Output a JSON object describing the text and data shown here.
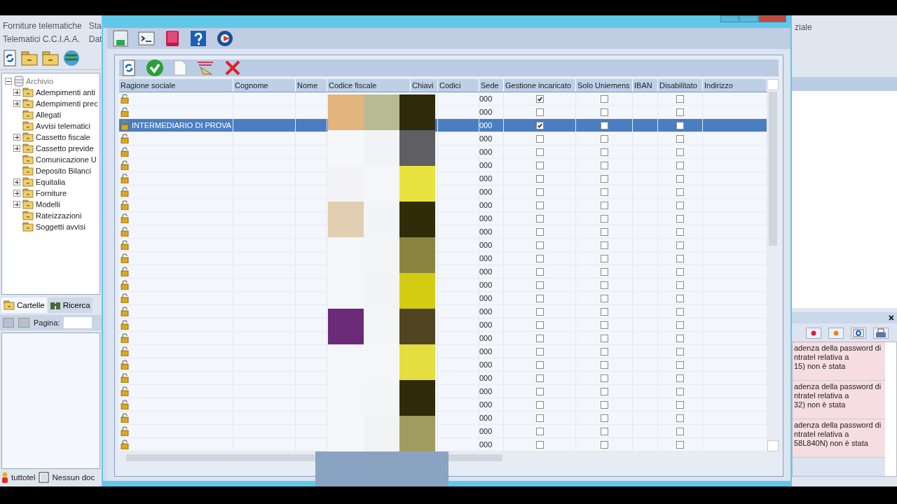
{
  "background_app": {
    "menu": [
      {
        "label": "Forniture telematiche"
      },
      {
        "label": "Sta"
      },
      {
        "label": "Telematici C.C.I.A.A."
      },
      {
        "label": "Dat"
      }
    ],
    "tree": {
      "label": "Archivio",
      "expanded": true,
      "children": [
        {
          "label": "Adempimenti anti",
          "collapsed": true
        },
        {
          "label": "Adempimenti prec",
          "collapsed": true
        },
        {
          "label": "Allegati",
          "collapsed": false
        },
        {
          "label": "Avvisi telematici",
          "collapsed": false
        },
        {
          "label": "Cassetto fiscale",
          "collapsed": true
        },
        {
          "label": "Cassetto previde",
          "collapsed": true
        },
        {
          "label": "Comunicazione U",
          "collapsed": false
        },
        {
          "label": "Deposito Bilanci",
          "collapsed": false
        },
        {
          "label": "Equitalia",
          "collapsed": true
        },
        {
          "label": "Forniture",
          "collapsed": true
        },
        {
          "label": "Modelli",
          "collapsed": true
        },
        {
          "label": "Rateizzazioni",
          "collapsed": false
        },
        {
          "label": "Soggetti avvisi",
          "collapsed": false
        }
      ]
    },
    "tabs": [
      {
        "label": "Cartelle",
        "selected": true
      },
      {
        "label": "Ricerca",
        "selected": false
      }
    ],
    "page_label": "Pagina:",
    "status_bar": {
      "user": "tuttotel",
      "document": "Nessun doc"
    },
    "right_menu": "ziale",
    "messages_panel": {
      "close": "×",
      "messages": [
        {
          "text": "adenza della password di\nntratel relativa a\n15) non è stata"
        },
        {
          "text": "adenza della password di\nntratel relativa a\n32) non è stata"
        },
        {
          "text": "adenza della password di\nntratel relativa a\n58L840N) non è stata"
        }
      ]
    }
  },
  "dialog": {
    "table": {
      "columns": [
        "Ragione sociale",
        "Cognome",
        "Nome",
        "Codice fiscale",
        "Chiavi",
        "Codici",
        "Sede",
        "Gestione incaricato",
        "Solo Uniemens",
        "IBAN",
        "Disabilitato",
        "Indirizzo"
      ],
      "rows": [
        {
          "sede": "000",
          "gestione_incaricato": true,
          "solo_uniemens": false,
          "disabilitato": false,
          "selected": false
        },
        {
          "sede": "000",
          "gestione_incaricato": false,
          "solo_uniemens": false,
          "disabilitato": false,
          "selected": false
        },
        {
          "name": "INTERMEDIARIO DI PROVA",
          "sede": "000",
          "gestione_incaricato": true,
          "solo_uniemens": false,
          "disabilitato": false,
          "selected": true
        },
        {
          "sede": "000",
          "gestione_incaricato": false,
          "solo_uniemens": false,
          "disabilitato": false,
          "selected": false
        },
        {
          "sede": "000",
          "gestione_incaricato": false,
          "solo_uniemens": false,
          "disabilitato": false,
          "selected": false
        },
        {
          "sede": "000",
          "gestione_incaricato": false,
          "solo_uniemens": false,
          "disabilitato": false,
          "selected": false
        },
        {
          "sede": "000",
          "gestione_incaricato": false,
          "solo_uniemens": false,
          "disabilitato": false,
          "selected": false
        },
        {
          "sede": "000",
          "gestione_incaricato": false,
          "solo_uniemens": false,
          "disabilitato": false,
          "selected": false
        },
        {
          "sede": "000",
          "gestione_incaricato": false,
          "solo_uniemens": false,
          "disabilitato": false,
          "selected": false
        },
        {
          "sede": "000",
          "gestione_incaricato": false,
          "solo_uniemens": false,
          "disabilitato": false,
          "selected": false
        },
        {
          "sede": "000",
          "gestione_incaricato": false,
          "solo_uniemens": false,
          "disabilitato": false,
          "selected": false
        },
        {
          "sede": "000",
          "gestione_incaricato": false,
          "solo_uniemens": false,
          "disabilitato": false,
          "selected": false
        },
        {
          "sede": "000",
          "gestione_incaricato": false,
          "solo_uniemens": false,
          "disabilitato": false,
          "selected": false
        },
        {
          "sede": "000",
          "gestione_incaricato": false,
          "solo_uniemens": false,
          "disabilitato": false,
          "selected": false
        },
        {
          "sede": "000",
          "gestione_incaricato": false,
          "solo_uniemens": false,
          "disabilitato": false,
          "selected": false
        },
        {
          "sede": "000",
          "gestione_incaricato": false,
          "solo_uniemens": false,
          "disabilitato": false,
          "selected": false
        },
        {
          "sede": "000",
          "gestione_incaricato": false,
          "solo_uniemens": false,
          "disabilitato": false,
          "selected": false
        },
        {
          "sede": "000",
          "gestione_incaricato": false,
          "solo_uniemens": false,
          "disabilitato": false,
          "selected": false
        },
        {
          "sede": "000",
          "gestione_incaricato": false,
          "solo_uniemens": false,
          "disabilitato": false,
          "selected": false
        },
        {
          "sede": "000",
          "gestione_incaricato": false,
          "solo_uniemens": false,
          "disabilitato": false,
          "selected": false
        },
        {
          "sede": "000",
          "gestione_incaricato": false,
          "solo_uniemens": false,
          "disabilitato": false,
          "selected": false
        },
        {
          "sede": "000",
          "gestione_incaricato": false,
          "solo_uniemens": false,
          "disabilitato": false,
          "selected": false
        },
        {
          "sede": "000",
          "gestione_incaricato": false,
          "solo_uniemens": false,
          "disabilitato": false,
          "selected": false
        },
        {
          "sede": "000",
          "gestione_incaricato": false,
          "solo_uniemens": false,
          "disabilitato": false,
          "selected": false
        },
        {
          "sede": "000",
          "gestione_incaricato": false,
          "solo_uniemens": false,
          "disabilitato": false,
          "selected": false
        },
        {
          "sede": "000",
          "gestione_incaricato": false,
          "solo_uniemens": false,
          "disabilitato": false,
          "selected": false
        },
        {
          "sede": "000",
          "gestione_incaricato": false,
          "solo_uniemens": false,
          "disabilitato": false,
          "selected": false
        }
      ]
    }
  }
}
